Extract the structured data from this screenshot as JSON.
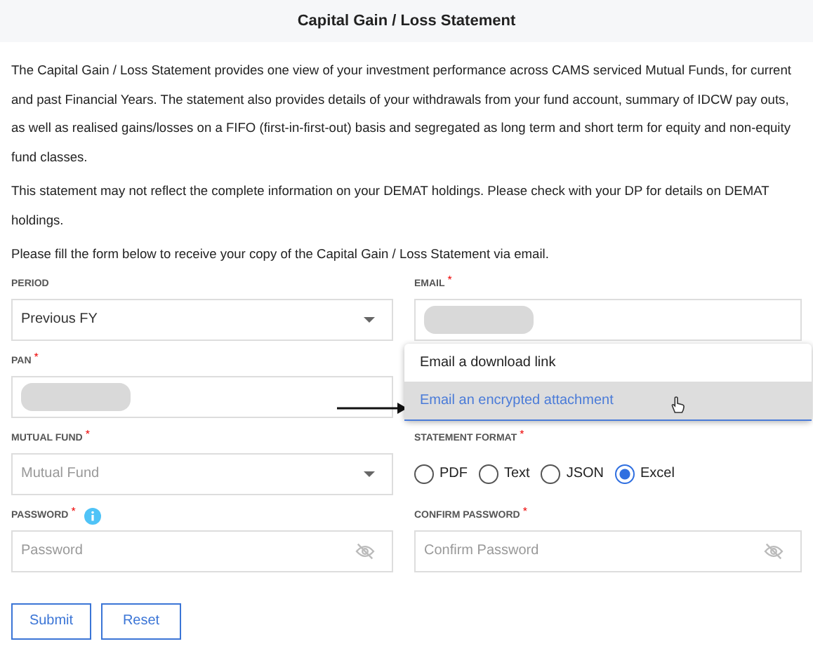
{
  "title": "Capital Gain / Loss Statement",
  "paragraphs": [
    "The Capital Gain / Loss Statement provides one view of your investment performance across CAMS serviced Mutual Funds, for current and past Financial Years. The statement also provides details of your withdrawals from your fund account, summary of IDCW pay outs, as well as realised gains/losses on a FIFO (first-in-first-out) basis and segregated as long term and short term for equity and non-equity fund classes.",
    "This statement may not reflect the complete information on your DEMAT holdings. Please check with your DP for details on DEMAT holdings.",
    "Please fill the form below to receive your copy of the Capital Gain / Loss Statement via email."
  ],
  "period": {
    "label": "PERIOD",
    "value": "Previous FY"
  },
  "email": {
    "label": "EMAIL",
    "mark": "*",
    "redacted": true
  },
  "pan": {
    "label": "PAN",
    "mark": "*",
    "redacted": true
  },
  "email_menu": [
    {
      "label": "Email a download link",
      "selected": false
    },
    {
      "label": "Email an encrypted attachment",
      "selected": true
    }
  ],
  "mutual_fund": {
    "label": "MUTUAL FUND",
    "mark": "*",
    "placeholder": "Mutual Fund"
  },
  "statement_format": {
    "label": "STATEMENT FORMAT",
    "mark": "*",
    "options": [
      {
        "label": "PDF",
        "selected": false
      },
      {
        "label": "Text",
        "selected": false
      },
      {
        "label": "JSON",
        "selected": false
      },
      {
        "label": "Excel",
        "selected": true
      }
    ]
  },
  "password": {
    "label": "PASSWORD",
    "mark": "*",
    "placeholder": "Password"
  },
  "confirm_password": {
    "label": "CONFIRM PASSWORD",
    "mark": "*",
    "placeholder": "Confirm Password"
  },
  "buttons": [
    "Submit",
    "Reset"
  ]
}
